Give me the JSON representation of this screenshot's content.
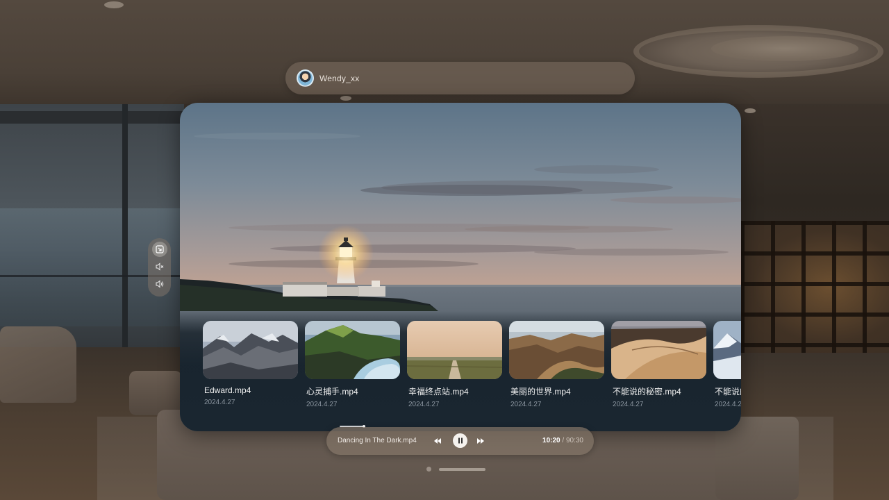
{
  "user": {
    "name": "Wendy_xx"
  },
  "thumbnails": [
    {
      "title": "Edward.mp4",
      "date": "2024.4.27"
    },
    {
      "title": "心灵捕手.mp4",
      "date": "2024.4.27"
    },
    {
      "title": "幸福终点站.mp4",
      "date": "2024.4.27"
    },
    {
      "title": "美丽的世界.mp4",
      "date": "2024.4.27"
    },
    {
      "title": "不能说的秘密.mp4",
      "date": "2024.4.27"
    },
    {
      "title": "不能说的",
      "date": "2024.4.2"
    }
  ],
  "side_controls": [
    {
      "icon": "picture-in-picture-icon",
      "active": true
    },
    {
      "icon": "mute-icon",
      "active": false
    },
    {
      "icon": "volume-icon",
      "active": false
    }
  ],
  "player": {
    "track": "Dancing In The Dark.mp4",
    "time_current": "10:20",
    "time_separator": "/",
    "time_total": "90:30",
    "progress": 0.114
  },
  "icons": {
    "prev": "rewind-icon",
    "pause": "pause-icon",
    "next": "fast-forward-icon"
  },
  "colors": {
    "panel_shade": "#1a2630",
    "accent_text": "#f1f1f1",
    "muted_text": "#8c96a0"
  }
}
